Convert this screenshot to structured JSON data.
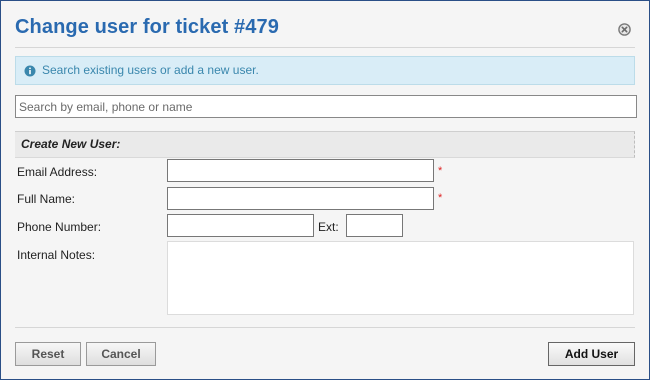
{
  "dialog": {
    "title": "Change user for ticket #479",
    "close_icon": "close-circle-icon",
    "info": {
      "icon": "info-circle-icon",
      "text": "Search existing users or add a new user."
    },
    "search": {
      "placeholder": "Search by email, phone or name",
      "value": ""
    }
  },
  "form": {
    "section_title": "Create New User:",
    "email_label": "Email Address:",
    "email_value": "",
    "full_name_label": "Full Name:",
    "full_name_value": "",
    "phone_label": "Phone Number:",
    "phone_value": "",
    "ext_label": "Ext:",
    "ext_value": "",
    "notes_label": "Internal Notes:",
    "notes_value": "",
    "required_marker": "*"
  },
  "buttons": {
    "reset": "Reset",
    "cancel": "Cancel",
    "add_user": "Add User"
  },
  "colors": {
    "title": "#2a6ab0",
    "info_bg": "#d9edf7",
    "info_text": "#3a87ad",
    "required": "#dd2222"
  }
}
